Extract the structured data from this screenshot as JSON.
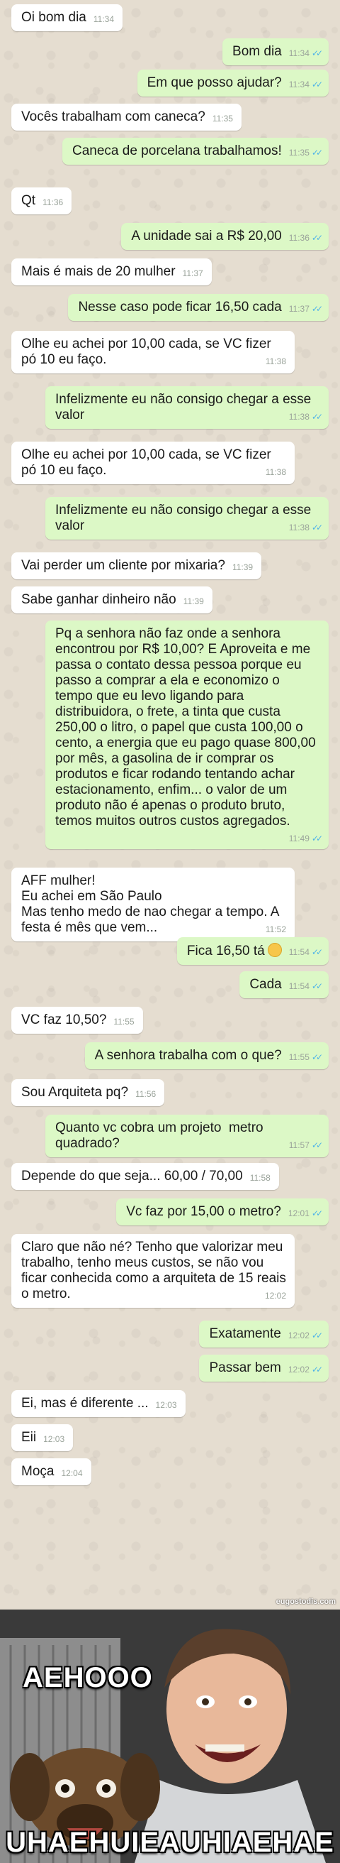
{
  "colors": {
    "incoming": "#ffffff",
    "outgoing": "#dcf8c6",
    "read_ticks": "#4fb3e8",
    "time": "#9aa39a"
  },
  "messages": [
    {
      "dir": "in",
      "text": "Oi bom dia",
      "time": "11:34"
    },
    {
      "dir": "out",
      "text": "Bom dia",
      "time": "11:34",
      "ticks": "✓✓"
    },
    {
      "dir": "out",
      "text": "Em que posso ajudar?",
      "time": "11:34",
      "ticks": "✓✓"
    },
    {
      "dir": "in",
      "text": "Vocês trabalham com caneca?",
      "time": "11:35"
    },
    {
      "dir": "out",
      "text": "Caneca de porcelana trabalhamos!",
      "time": "11:35",
      "ticks": "✓✓"
    },
    {
      "dir": "in",
      "text": "Qt",
      "time": "11:36"
    },
    {
      "dir": "out",
      "text": "A unidade sai a R$ 20,00",
      "time": "11:36",
      "ticks": "✓✓"
    },
    {
      "dir": "in",
      "text": "Mais é mais de 20 mulher",
      "time": "11:37"
    },
    {
      "dir": "out",
      "text": "Nesse caso pode ficar 16,50 cada",
      "time": "11:37",
      "ticks": "✓✓"
    },
    {
      "dir": "in",
      "text": "Olhe eu achei por 10,00 cada, se VC fizer pó 10 eu faço.",
      "time": "11:38"
    },
    {
      "dir": "out",
      "text": "Infelizmente eu não consigo chegar a esse valor",
      "time": "11:38",
      "ticks": "✓✓"
    },
    {
      "dir": "in",
      "text": "Olhe eu achei por 10,00 cada, se VC fizer pó 10 eu faço.",
      "time": "11:38"
    },
    {
      "dir": "out",
      "text": "Infelizmente eu não consigo chegar a esse valor",
      "time": "11:38",
      "ticks": "✓✓"
    },
    {
      "dir": "in",
      "text": "Vai perder um cliente por mixaria?",
      "time": "11:39"
    },
    {
      "dir": "in",
      "text": "Sabe ganhar dinheiro não",
      "time": "11:39"
    },
    {
      "dir": "out",
      "text": "Pq a senhora não faz onde a senhora encontrou por R$ 10,00? E Aproveita e me passa o contato dessa pessoa porque eu passo a comprar a ela e economizo o tempo que eu levo ligando para distribuidora, o frete, a tinta que custa 250,00 o litro, o papel que custa 100,00 o cento, a energia que eu pago quase 800,00 por mês, a gasolina de ir comprar os produtos e ficar rodando tentando achar estacionamento, enfim... o valor de um produto não é apenas o produto bruto, temos muitos outros custos agregados.",
      "time": "11:49",
      "ticks": "✓✓"
    },
    {
      "dir": "in",
      "text": "AFF mulher!\nEu achei em São Paulo\nMas tenho medo de nao chegar a tempo. A festa é mês que vem...",
      "time": "11:52"
    },
    {
      "dir": "out",
      "text": "Fica 16,50 tá",
      "time": "11:54",
      "ticks": "✓✓",
      "emoji": "wink-emoji"
    },
    {
      "dir": "out",
      "text": "Cada",
      "time": "11:54",
      "ticks": "✓✓"
    },
    {
      "dir": "in",
      "text": "VC faz 10,50?",
      "time": "11:55"
    },
    {
      "dir": "out",
      "text": "A senhora trabalha com o que?",
      "time": "11:55",
      "ticks": "✓✓"
    },
    {
      "dir": "in",
      "text": "Sou Arquiteta pq?",
      "time": "11:56"
    },
    {
      "dir": "out",
      "text": "Quanto vc cobra um projeto  metro quadrado?",
      "time": "11:57",
      "ticks": "✓✓"
    },
    {
      "dir": "in",
      "text": "Depende do que seja... 60,00 / 70,00",
      "time": "11:58"
    },
    {
      "dir": "out",
      "text": "Vc faz por 15,00 o metro?",
      "time": "12:01",
      "ticks": "✓✓"
    },
    {
      "dir": "in",
      "text": "Claro que não né? Tenho que valorizar meu trabalho, tenho meus custos, se não vou ficar conhecida como a arquiteta de 15 reais o metro.",
      "time": "12:02"
    },
    {
      "dir": "out",
      "text": "Exatamente",
      "time": "12:02",
      "ticks": "✓✓"
    },
    {
      "dir": "out",
      "text": "Passar bem",
      "time": "12:02",
      "ticks": "✓✓"
    },
    {
      "dir": "in",
      "text": "Ei, mas é diferente ...",
      "time": "12:03"
    },
    {
      "dir": "in",
      "text": "Eii",
      "time": "12:03"
    },
    {
      "dir": "in",
      "text": "Moça",
      "time": "12:04"
    }
  ],
  "meme": {
    "top_text": "AEHOOO",
    "bottom_text": "UHAEHUIEAUHIAEHAE",
    "watermark": "eugostodis.com"
  }
}
